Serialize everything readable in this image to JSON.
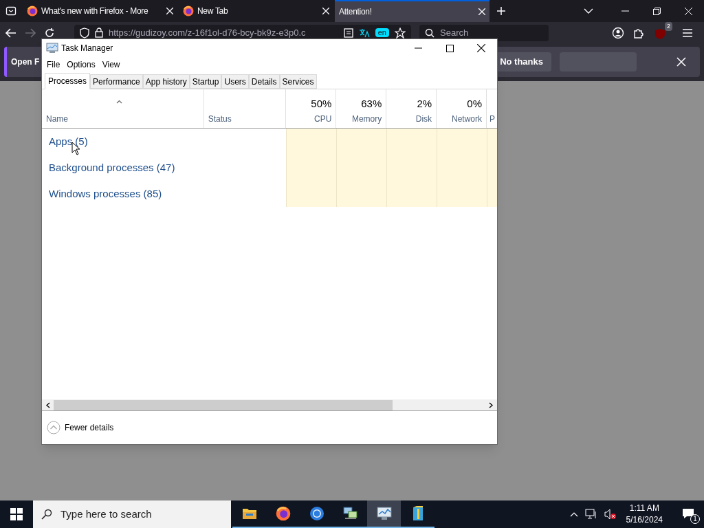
{
  "browser": {
    "tabs": [
      {
        "label": "What's new with Firefox - More",
        "favicon": true,
        "selected": false
      },
      {
        "label": "New Tab",
        "favicon": true,
        "selected": false
      },
      {
        "label": "Attention!",
        "favicon": false,
        "selected": true
      }
    ],
    "url": "https://gudizoy.com/z-16f1ol-d76-bcy-bk9z-e3p0.c",
    "search_placeholder": "Search",
    "extension_badge": "2",
    "translate_badge": "en",
    "notification": {
      "text": "Open F",
      "buttons": [
        "No thanks"
      ]
    }
  },
  "task_manager": {
    "title": "Task Manager",
    "menu": [
      "File",
      "Options",
      "View"
    ],
    "tabs": [
      {
        "label": "Processes",
        "selected": true
      },
      {
        "label": "Performance",
        "selected": false
      },
      {
        "label": "App history",
        "selected": false
      },
      {
        "label": "Startup",
        "selected": false
      },
      {
        "label": "Users",
        "selected": false
      },
      {
        "label": "Details",
        "selected": false
      },
      {
        "label": "Services",
        "selected": false
      }
    ],
    "columns": [
      {
        "kind": "text",
        "label": "Name"
      },
      {
        "kind": "text",
        "label": "Status"
      },
      {
        "kind": "metric",
        "percent": "50%",
        "label": "CPU"
      },
      {
        "kind": "metric",
        "percent": "63%",
        "label": "Memory"
      },
      {
        "kind": "metric",
        "percent": "2%",
        "label": "Disk"
      },
      {
        "kind": "metric",
        "percent": "0%",
        "label": "Network"
      },
      {
        "kind": "cut",
        "label": "P"
      }
    ],
    "groups": [
      "Apps (5)",
      "Background processes (47)",
      "Windows processes (85)"
    ],
    "fewer_details": "Fewer details"
  },
  "taskbar": {
    "search_placeholder": "Type here to search",
    "apps": [
      {
        "kind": "folder",
        "selected": false
      },
      {
        "kind": "firefox",
        "selected": false
      },
      {
        "kind": "chrome",
        "selected": false
      },
      {
        "kind": "network",
        "selected": false
      },
      {
        "kind": "monitor",
        "selected": true
      },
      {
        "kind": "archive",
        "selected": false
      }
    ],
    "time": "1:11 AM",
    "date": "5/16/2024",
    "notification_count": "1"
  }
}
